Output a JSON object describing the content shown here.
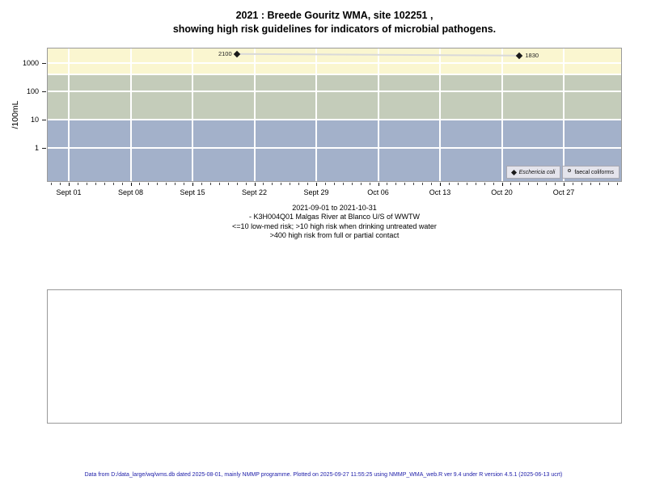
{
  "title": {
    "line1": "2021 : Breede Gouritz WMA, site 102251 ,",
    "line2": "showing high risk guidelines for indicators of microbial pathogens."
  },
  "chart_data": {
    "type": "scatter",
    "title": "2021 : Breede Gouritz WMA, site 102251 , showing high risk guidelines for indicators of microbial pathogens.",
    "xlabel": "",
    "ylabel": "/100mL",
    "y_scale": "log10",
    "ylim": [
      0.06,
      3500
    ],
    "xlim": [
      "2021-08-29",
      "2021-11-02"
    ],
    "grid": true,
    "grid_color": "#ffffff",
    "y_ticks": [
      1,
      10,
      100,
      1000
    ],
    "x_ticks": [
      {
        "label": "Sept 01",
        "day": 0
      },
      {
        "label": "Sept 08",
        "day": 7
      },
      {
        "label": "Sept 15",
        "day": 14
      },
      {
        "label": "Sept 22",
        "day": 21
      },
      {
        "label": "Sept 29",
        "day": 28
      },
      {
        "label": "Oct 06",
        "day": 35
      },
      {
        "label": "Oct 13",
        "day": 42
      },
      {
        "label": "Oct 20",
        "day": 49
      },
      {
        "label": "Oct 27",
        "day": 56
      }
    ],
    "x_minor_tick_days": [
      -2,
      62
    ],
    "gridlines_y_values": [
      1,
      10,
      100,
      400,
      1000
    ],
    "series": [
      {
        "name": "Eschericia coli",
        "marker": "filled-diamond",
        "color": "#1a1a1a",
        "line_color": "#D9D9D9",
        "points": [
          {
            "date": "2021-09-20",
            "day": 19,
            "value": 2100,
            "label": "2100",
            "label_side": "left"
          },
          {
            "date": "2021-10-22",
            "day": 51,
            "value": 1830,
            "label": "1830",
            "label_side": "right"
          }
        ]
      },
      {
        "name": "faecal coliforms",
        "marker": "open-circle",
        "color": "#1a1a1a",
        "points": []
      }
    ],
    "bands": [
      {
        "name": "above-400-high-risk-contact",
        "min": 400,
        "max": null,
        "color": "#FAF6D0"
      },
      {
        "name": "10-400-high-risk-drinking",
        "min": 10,
        "max": 400,
        "color": "#C4CCBA"
      },
      {
        "name": "below-10-low-med-risk",
        "min": null,
        "max": 10,
        "color": "#A3B1CA"
      }
    ],
    "legend_position": "bottom-right"
  },
  "legend": {
    "items": [
      {
        "label": "Eschericia coli",
        "marker": "filled-diamond",
        "italic": true
      },
      {
        "label": "faecal coliforms",
        "marker": "open-circle",
        "italic": false
      }
    ]
  },
  "caption": {
    "line1": "2021-09-01 to 2021-10-31",
    "line2": "- K3H004Q01 Malgas River at Blanco U/S of WWTW",
    "line3": "<=10 low-med risk; >10 high risk when drinking untreated water",
    "line4": ">400 high risk from full or partial contact"
  },
  "footer": {
    "text": "Data from D:/data_large/wq/wms.db dated 2025-08-01, mainly NMMP programme. Plotted on 2025-09-27 11:55:25 using NMMP_WMA_web.R ver 9.4 under R version 4.5.1 (2025-06-13 ucrt)"
  }
}
